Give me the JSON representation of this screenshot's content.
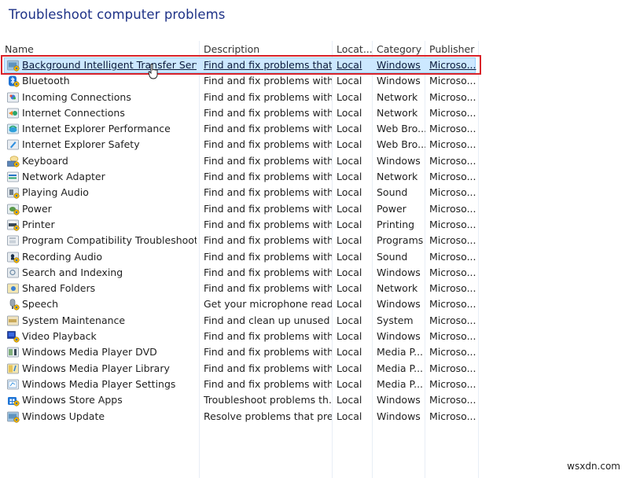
{
  "page": {
    "title": "Troubleshoot computer problems",
    "watermark": "wsxdn.com"
  },
  "table": {
    "columns": [
      "Name",
      "Description",
      "Locat...",
      "Category",
      "Publisher"
    ],
    "selected_index": 0,
    "rows": [
      {
        "icon": "bits-transfer-icon",
        "name": "Background Intelligent Transfer Service",
        "description": "Find and fix problems that...",
        "location": "Local",
        "category": "Windows",
        "publisher": "Microso..."
      },
      {
        "icon": "bluetooth-icon",
        "name": "Bluetooth",
        "description": "Find and fix problems with...",
        "location": "Local",
        "category": "Windows",
        "publisher": "Microso..."
      },
      {
        "icon": "incoming-connections-icon",
        "name": "Incoming Connections",
        "description": "Find and fix problems with...",
        "location": "Local",
        "category": "Network",
        "publisher": "Microso..."
      },
      {
        "icon": "internet-connections-icon",
        "name": "Internet Connections",
        "description": "Find and fix problems with...",
        "location": "Local",
        "category": "Network",
        "publisher": "Microso..."
      },
      {
        "icon": "ie-performance-icon",
        "name": "Internet Explorer Performance",
        "description": "Find and fix problems with...",
        "location": "Local",
        "category": "Web Bro...",
        "publisher": "Microso..."
      },
      {
        "icon": "ie-safety-icon",
        "name": "Internet Explorer Safety",
        "description": "Find and fix problems with...",
        "location": "Local",
        "category": "Web Bro...",
        "publisher": "Microso..."
      },
      {
        "icon": "keyboard-icon",
        "name": "Keyboard",
        "description": "Find and fix problems with...",
        "location": "Local",
        "category": "Windows",
        "publisher": "Microso..."
      },
      {
        "icon": "network-adapter-icon",
        "name": "Network Adapter",
        "description": "Find and fix problems with...",
        "location": "Local",
        "category": "Network",
        "publisher": "Microso..."
      },
      {
        "icon": "playing-audio-icon",
        "name": "Playing Audio",
        "description": "Find and fix problems with...",
        "location": "Local",
        "category": "Sound",
        "publisher": "Microso..."
      },
      {
        "icon": "power-icon",
        "name": "Power",
        "description": "Find and fix problems with...",
        "location": "Local",
        "category": "Power",
        "publisher": "Microso..."
      },
      {
        "icon": "printer-icon",
        "name": "Printer",
        "description": "Find and fix problems with...",
        "location": "Local",
        "category": "Printing",
        "publisher": "Microso..."
      },
      {
        "icon": "program-compatibility-icon",
        "name": "Program Compatibility Troubleshooter",
        "description": "Find and fix problems with...",
        "location": "Local",
        "category": "Programs",
        "publisher": "Microso..."
      },
      {
        "icon": "recording-audio-icon",
        "name": "Recording Audio",
        "description": "Find and fix problems with...",
        "location": "Local",
        "category": "Sound",
        "publisher": "Microso..."
      },
      {
        "icon": "search-indexing-icon",
        "name": "Search and Indexing",
        "description": "Find and fix problems with...",
        "location": "Local",
        "category": "Windows",
        "publisher": "Microso..."
      },
      {
        "icon": "shared-folders-icon",
        "name": "Shared Folders",
        "description": "Find and fix problems with...",
        "location": "Local",
        "category": "Network",
        "publisher": "Microso..."
      },
      {
        "icon": "speech-icon",
        "name": "Speech",
        "description": "Get your microphone read...",
        "location": "Local",
        "category": "Windows",
        "publisher": "Microso..."
      },
      {
        "icon": "system-maintenance-icon",
        "name": "System Maintenance",
        "description": "Find and clean up unused f...",
        "location": "Local",
        "category": "System",
        "publisher": "Microso..."
      },
      {
        "icon": "video-playback-icon",
        "name": "Video Playback",
        "description": "Find and fix problems with...",
        "location": "Local",
        "category": "Windows",
        "publisher": "Microso..."
      },
      {
        "icon": "wmp-dvd-icon",
        "name": "Windows Media Player DVD",
        "description": "Find and fix problems with...",
        "location": "Local",
        "category": "Media P...",
        "publisher": "Microso..."
      },
      {
        "icon": "wmp-library-icon",
        "name": "Windows Media Player Library",
        "description": "Find and fix problems with...",
        "location": "Local",
        "category": "Media P...",
        "publisher": "Microso..."
      },
      {
        "icon": "wmp-settings-icon",
        "name": "Windows Media Player Settings",
        "description": "Find and fix problems with...",
        "location": "Local",
        "category": "Media P...",
        "publisher": "Microso..."
      },
      {
        "icon": "windows-store-apps-icon",
        "name": "Windows Store Apps",
        "description": "Troubleshoot problems th...",
        "location": "Local",
        "category": "Windows",
        "publisher": "Microso..."
      },
      {
        "icon": "windows-update-icon",
        "name": "Windows Update",
        "description": "Resolve problems that pre...",
        "location": "Local",
        "category": "Windows",
        "publisher": "Microso..."
      }
    ]
  },
  "colors": {
    "title": "#1e3287",
    "selection_bg": "#cce8ff",
    "highlight_outline": "#d92229"
  }
}
